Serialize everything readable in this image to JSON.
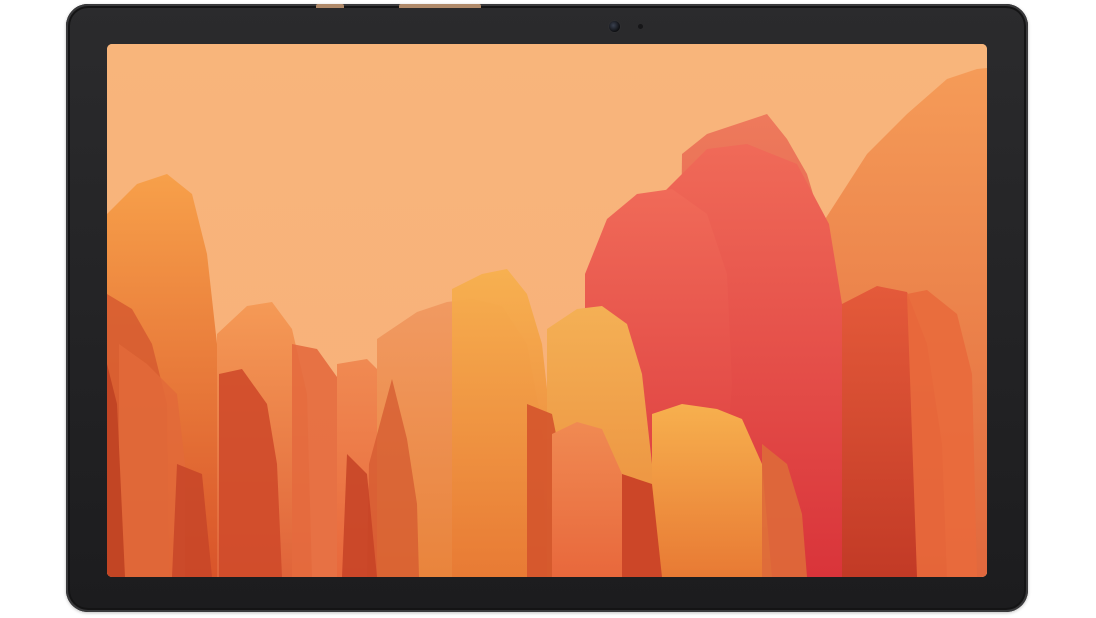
{
  "device": {
    "frame_color": "#1f1f21",
    "accent_color": "#b08a6a"
  },
  "wallpaper": {
    "background_color": "#f9b97e",
    "palette": [
      "#f48a2c",
      "#f26a4a",
      "#e8453c",
      "#f7a24e",
      "#e97a3a",
      "#d94a2e",
      "#f3905a"
    ]
  }
}
